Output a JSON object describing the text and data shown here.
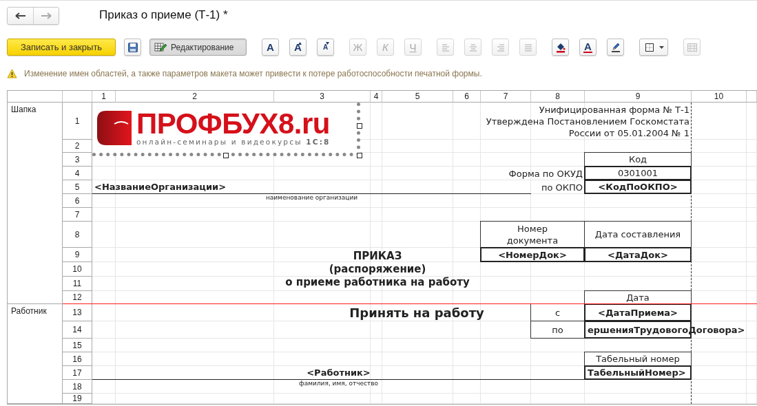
{
  "window": {
    "title": "Приказ о приеме (Т-1) *"
  },
  "navigation": [
    {
      "kind": "back",
      "disabled": false
    },
    {
      "kind": "forward",
      "disabled": true
    }
  ],
  "toolbar": {
    "groups": [
      [
        {
          "kind": "primary",
          "label": "Записать и закрыть",
          "disabled": false
        }
      ],
      [
        {
          "kind": "save",
          "disabled": false
        }
      ],
      [
        {
          "kind": "toggle",
          "label": "Редактирование",
          "pressed": true
        }
      ],
      [
        {
          "kind": "font",
          "label": "A",
          "disabled": false
        },
        {
          "kind": "grow",
          "label": "A",
          "disabled": false
        },
        {
          "kind": "shrink",
          "label": "A",
          "disabled": false
        }
      ],
      [
        {
          "kind": "bold",
          "label": "Ж",
          "disabled": true
        },
        {
          "kind": "italic",
          "label": "К",
          "disabled": true
        },
        {
          "kind": "underline",
          "label": "Ч",
          "disabled": true
        }
      ],
      [
        {
          "kind": "alignleft",
          "disabled": true
        },
        {
          "kind": "aligncenter",
          "disabled": true
        },
        {
          "kind": "alignright",
          "disabled": true
        },
        {
          "kind": "justify",
          "disabled": true
        }
      ],
      [
        {
          "kind": "fill",
          "disabled": false
        },
        {
          "kind": "color",
          "label": "A",
          "disabled": false
        },
        {
          "kind": "pen",
          "disabled": false
        }
      ],
      [
        {
          "kind": "borders",
          "disabled": false
        }
      ],
      [
        {
          "kind": "table",
          "disabled": true
        }
      ]
    ]
  },
  "warning": {
    "text": "Изменение имен областей, а также параметров макета может привести к потере работоспособности печатной формы."
  },
  "sheet": {
    "columns": [
      "1",
      "2",
      "3",
      "4",
      "5",
      "6",
      "7",
      "8",
      "9",
      "10"
    ],
    "areas": [
      {
        "name": "Шапка",
        "rows": [
          "1",
          "2",
          "3",
          "4",
          "5",
          "6",
          "7",
          "8",
          "9",
          "10",
          "11",
          "12"
        ]
      },
      {
        "name": "Работник",
        "rows": [
          "13",
          "14",
          "15",
          "16",
          "17",
          "18",
          "19"
        ]
      }
    ],
    "logo": {
      "title": "ПРОФБУХ8.ru",
      "tagline": "онлайн-семинары и видеокурсы **1С:8**",
      "selected": true
    },
    "cells": [
      {
        "text": "Унифицированная форма № Т-1\nУтверждена Постановлением Госкомстата\nРоссии от 05.01.2004 № 1",
        "kind": "note"
      },
      {
        "text": "Код",
        "kind": "box"
      },
      {
        "text": "Форма по ОКУД",
        "kind": "note"
      },
      {
        "text": "0301001",
        "kind": "code"
      },
      {
        "text": "<НазваниеОрганизации>",
        "kind": "namefield"
      },
      {
        "text": "по ОКПО",
        "kind": "note"
      },
      {
        "text": "<КодПоОКПО>",
        "kind": "param"
      },
      {
        "text": "наименование организации",
        "kind": "caption"
      },
      {
        "text": "Номер\nдокумента",
        "kind": "box"
      },
      {
        "text": "Дата составления",
        "kind": "box"
      },
      {
        "text": "ПРИКАЗ\n(распоряжение)\nо приеме работника на работу",
        "kind": "title"
      },
      {
        "text": "<НомерДок>",
        "kind": "param"
      },
      {
        "text": "<ДатаДок>",
        "kind": "param"
      },
      {
        "text": "Дата",
        "kind": "box"
      },
      {
        "text": "Принять на работу",
        "kind": "heading"
      },
      {
        "text": "с",
        "kind": "box"
      },
      {
        "text": "<ДатаПриема>",
        "kind": "param"
      },
      {
        "text": "по",
        "kind": "box"
      },
      {
        "text": "ершенияТрудовогоДоговора>",
        "kind": "overflow"
      },
      {
        "text": "Табельный номер",
        "kind": "box"
      },
      {
        "text": "<Работник>",
        "kind": "personfield"
      },
      {
        "text": "ТабельныйНомер>",
        "kind": "overflow"
      },
      {
        "text": "фамилия, имя, отчество",
        "kind": "caption"
      }
    ]
  }
}
